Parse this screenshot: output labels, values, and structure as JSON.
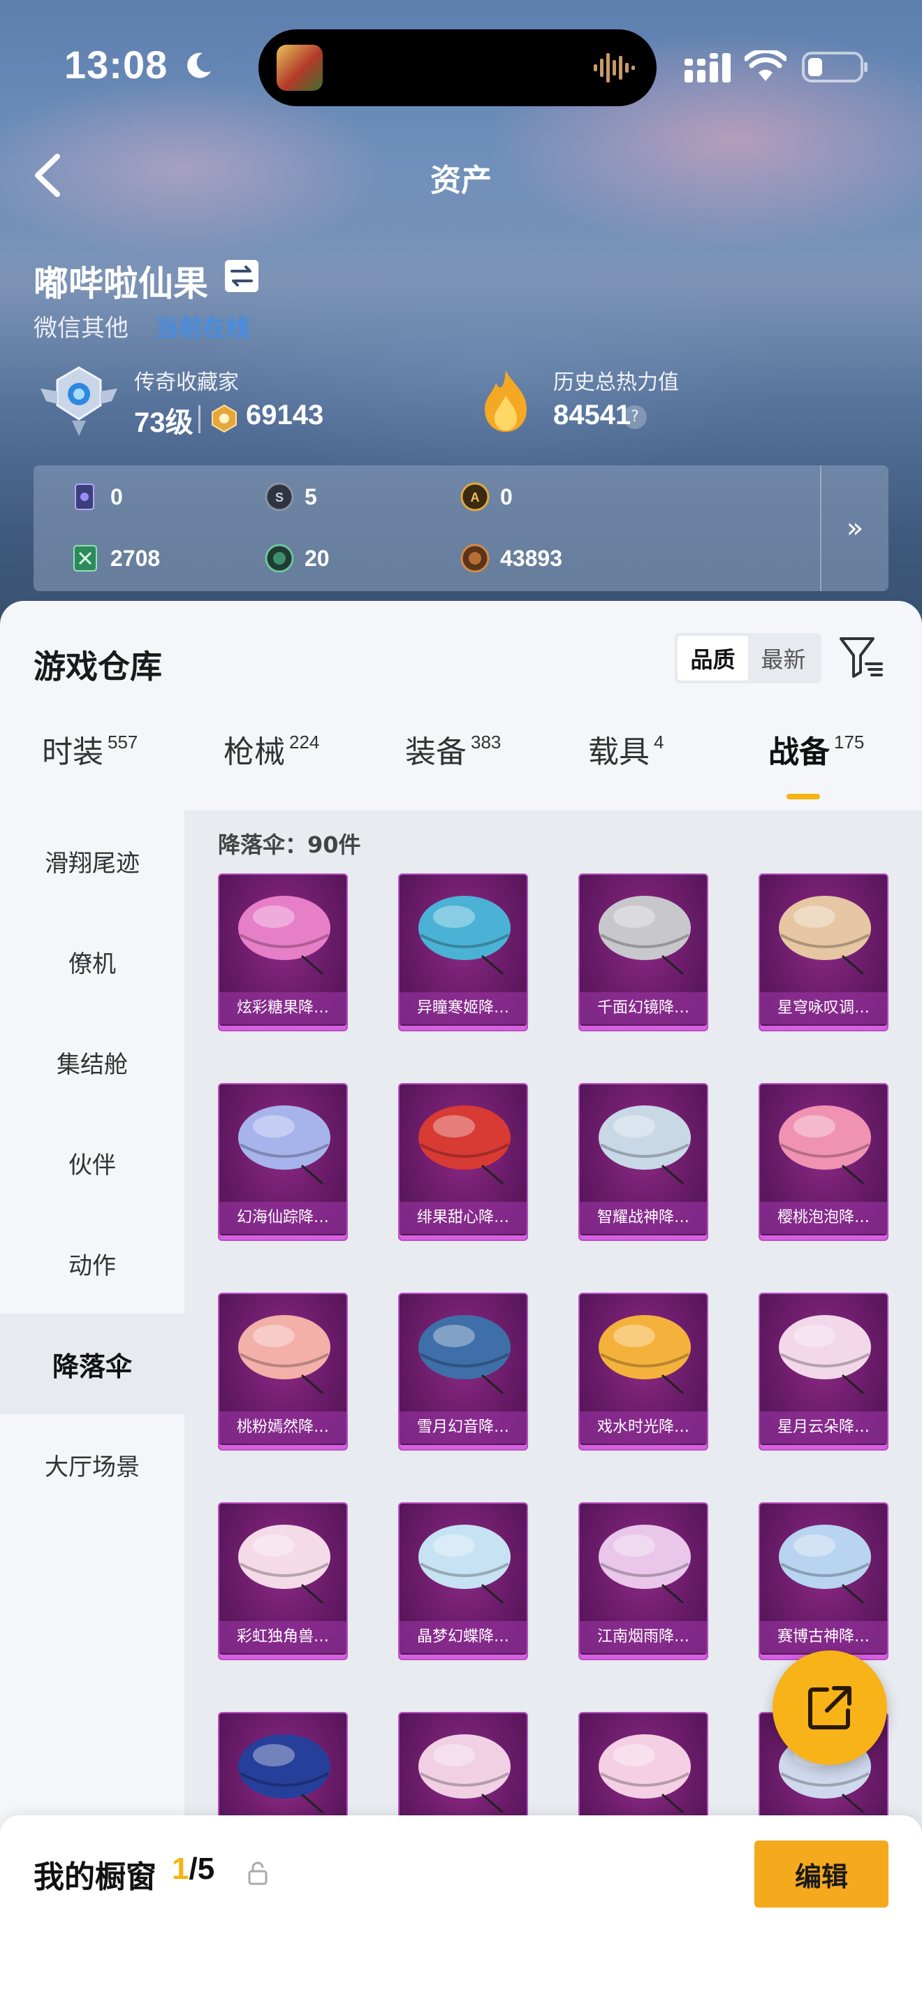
{
  "status_bar": {
    "time": "13:08"
  },
  "nav": {
    "title": "资产"
  },
  "profile": {
    "name": "嘟哔啦仙果",
    "sub": "微信其他",
    "online": "当前在线",
    "collector_title": "传奇收藏家",
    "level": "73级",
    "score": "69143",
    "heat_title": "历史总热力值",
    "heat_value": "84541",
    "help": "?"
  },
  "currencies": [
    {
      "value": "0",
      "icon": "card-icon"
    },
    {
      "value": "5",
      "icon": "coin-s-icon"
    },
    {
      "value": "0",
      "icon": "coin-a-icon"
    },
    {
      "value": "2708",
      "icon": "ticket-icon"
    },
    {
      "value": "20",
      "icon": "green-coin-icon"
    },
    {
      "value": "43893",
      "icon": "bronze-coin-icon"
    }
  ],
  "currencies_more": "»",
  "warehouse": {
    "title": "游戏仓库",
    "sort_options": [
      "品质",
      "最新"
    ],
    "sort_active": "品质"
  },
  "tabs": [
    {
      "label": "时装",
      "count": "557"
    },
    {
      "label": "枪械",
      "count": "224"
    },
    {
      "label": "装备",
      "count": "383"
    },
    {
      "label": "载具",
      "count": "4"
    },
    {
      "label": "战备",
      "count": "175",
      "active": true
    }
  ],
  "sidebar": [
    {
      "label": "滑翔尾迹"
    },
    {
      "label": "僚机"
    },
    {
      "label": "集结舱"
    },
    {
      "label": "伙伴"
    },
    {
      "label": "动作"
    },
    {
      "label": "降落伞",
      "active": true
    },
    {
      "label": "大厅场景"
    }
  ],
  "section_title": "降落伞：90件",
  "items": [
    {
      "name": "炫彩糖果降…",
      "color": "#e77ec8"
    },
    {
      "name": "异瞳寒姬降…",
      "color": "#4bb2d6"
    },
    {
      "name": "千面幻镜降…",
      "color": "#c8c8cc"
    },
    {
      "name": "星穹咏叹调…",
      "color": "#e6c6a3"
    },
    {
      "name": "幻海仙踪降…",
      "color": "#a7b4ec"
    },
    {
      "name": "绯果甜心降…",
      "color": "#d83a34"
    },
    {
      "name": "智耀战神降…",
      "color": "#c9d8e6"
    },
    {
      "name": "樱桃泡泡降…",
      "color": "#f092b2"
    },
    {
      "name": "桃粉嫣然降…",
      "color": "#f3b0a8"
    },
    {
      "name": "雪月幻音降…",
      "color": "#3f6fa8"
    },
    {
      "name": "戏水时光降…",
      "color": "#f4b23c"
    },
    {
      "name": "星月云朵降…",
      "color": "#f2d8e8"
    },
    {
      "name": "彩虹独角兽…",
      "color": "#f4dbe7"
    },
    {
      "name": "晶梦幻蝶降…",
      "color": "#c7e2f3"
    },
    {
      "name": "江南烟雨降…",
      "color": "#e9c6ea"
    },
    {
      "name": "赛博古神降…",
      "color": "#b8d4f0"
    },
    {
      "name": "",
      "color": "#263f9a"
    },
    {
      "name": "",
      "color": "#f1d0e4"
    },
    {
      "name": "",
      "color": "#f5cfe3"
    },
    {
      "name": "",
      "color": "#cfd8ec"
    }
  ],
  "showcase": {
    "label": "我的橱窗",
    "current": "1",
    "total": "/5"
  },
  "edit_label": "编辑"
}
